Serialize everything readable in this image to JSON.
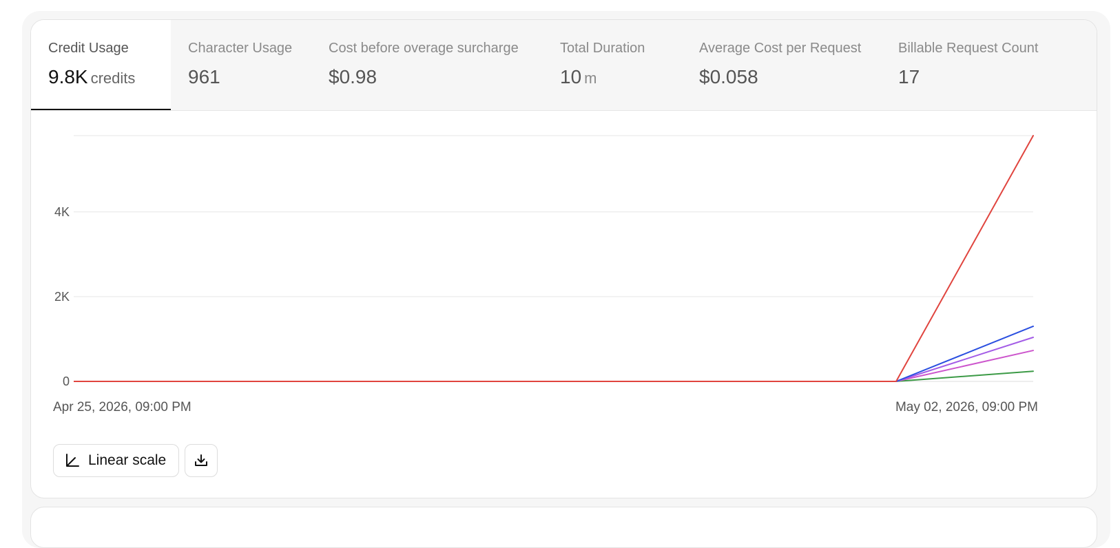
{
  "tabs": [
    {
      "label": "Credit Usage",
      "value": "9.8K",
      "unit": "credits",
      "active": true
    },
    {
      "label": "Character Usage",
      "value": "961",
      "unit": "",
      "active": false
    },
    {
      "label": "Cost before overage surcharge",
      "value": "$0.98",
      "unit": "",
      "active": false
    },
    {
      "label": "Total Duration",
      "value": "10",
      "unit": "m",
      "active": false
    },
    {
      "label": "Average Cost per Request",
      "value": "$0.058",
      "unit": "",
      "active": false
    },
    {
      "label": "Billable Request Count",
      "value": "17",
      "unit": "",
      "active": false
    }
  ],
  "chart_data": {
    "type": "line",
    "x": [
      "Apr 25, 2026, 09:00 PM",
      "May 02, 2026, 09:00 PM"
    ],
    "x_tick_labels": [
      "Apr 25, 2026, 09:00 PM",
      "May 02, 2026, 09:00 PM"
    ],
    "y_ticks": [
      0,
      2000,
      4000
    ],
    "y_tick_labels": [
      "0",
      "2K",
      "4K"
    ],
    "ylim": [
      0,
      5800
    ],
    "grid": true,
    "series": [
      {
        "color": "#e0443e",
        "values": [
          0,
          5800
        ]
      },
      {
        "color": "#2a4fe0",
        "values": [
          0,
          1300
        ]
      },
      {
        "color": "#a35ce6",
        "values": [
          0,
          1040
        ]
      },
      {
        "color": "#cc55cc",
        "values": [
          0,
          730
        ]
      },
      {
        "color": "#3c9a46",
        "values": [
          0,
          240
        ]
      }
    ]
  },
  "controls": {
    "scale_label": "Linear scale",
    "scale_icon": "chart-axis-icon",
    "download_icon": "download-icon"
  }
}
